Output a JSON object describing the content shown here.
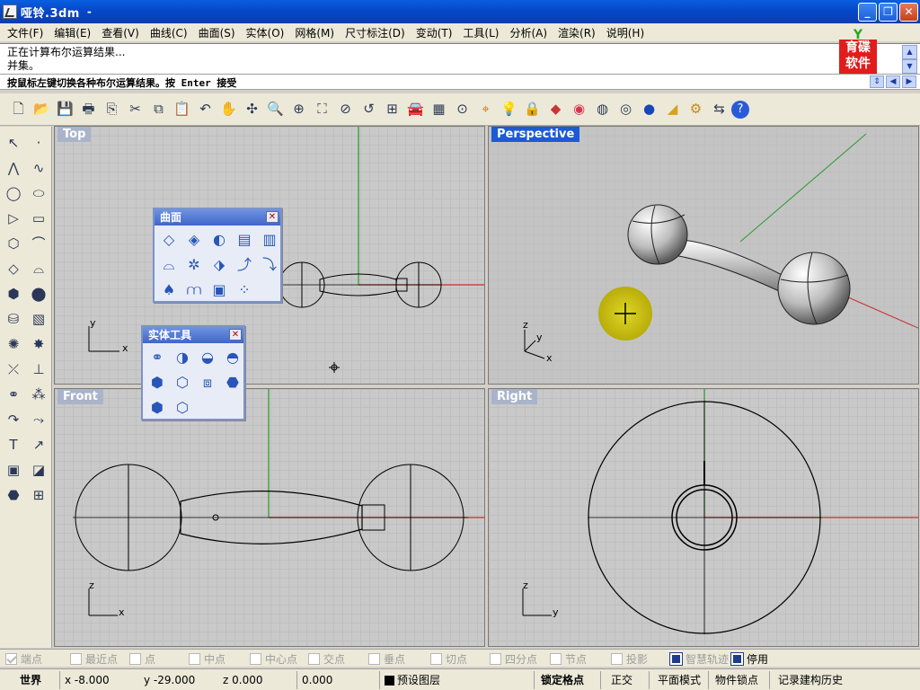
{
  "window": {
    "title": "哑铃.3dm",
    "title_suffix": "-"
  },
  "menu": [
    "文件(F)",
    "编辑(E)",
    "查看(V)",
    "曲线(C)",
    "曲面(S)",
    "实体(O)",
    "网格(M)",
    "尺寸标注(D)",
    "变动(T)",
    "工具(L)",
    "分析(A)",
    "渲染(R)",
    "说明(H)"
  ],
  "logo": {
    "line1": "育碟",
    "line2": "软件",
    "leaf": "Y"
  },
  "command": {
    "history": [
      "正在计算布尔运算结果...",
      "并集。"
    ],
    "prompt": "按鼠标左键切换各种布尔运算结果。按 Enter 接受"
  },
  "toolbar_icons": [
    "new-file-icon",
    "open-icon",
    "save-icon",
    "print-icon",
    "import-icon",
    "cut-icon",
    "copy-icon",
    "paste-icon",
    "undo-icon",
    "pan-hand-icon",
    "rotate-view-icon",
    "zoom-dynamic-icon",
    "zoom-window-icon",
    "zoom-extents-icon",
    "zoom-selected-icon",
    "undo-view-icon",
    "four-viewports-icon",
    "car-icon",
    "grid-icon",
    "snap-point-icon",
    "gumball-icon",
    "light-icon",
    "lock-icon",
    "layer-icon",
    "color-wheel-icon",
    "wireframe-icon",
    "ghost-sphere-icon",
    "shaded-sphere-icon",
    "render-icon",
    "settings-gear-icon",
    "history-icon",
    "help-icon"
  ],
  "viewports": {
    "top": "Top",
    "perspective": "Perspective",
    "front": "Front",
    "right": "Right"
  },
  "axes": {
    "x": "x",
    "y": "y",
    "z": "z"
  },
  "panels": {
    "surface": {
      "title": "曲面"
    },
    "solid": {
      "title": "实体工具"
    }
  },
  "colors": {
    "active_viewport": "#1a5bd6",
    "inactive_viewport": "#a9b4cb",
    "x_axis": "#cc2b2b",
    "y_axis": "#2c9a2c",
    "highlight": "#c9c100"
  },
  "snaps": [
    {
      "label": "端点",
      "checked": true,
      "enabled": false
    },
    {
      "label": "最近点",
      "checked": false,
      "enabled": false
    },
    {
      "label": "点",
      "checked": false,
      "enabled": false
    },
    {
      "label": "中点",
      "checked": false,
      "enabled": false
    },
    {
      "label": "中心点",
      "checked": false,
      "enabled": false
    },
    {
      "label": "交点",
      "checked": false,
      "enabled": false
    },
    {
      "label": "垂点",
      "checked": false,
      "enabled": false
    },
    {
      "label": "切点",
      "checked": false,
      "enabled": false
    },
    {
      "label": "四分点",
      "checked": false,
      "enabled": false
    },
    {
      "label": "节点",
      "checked": false,
      "enabled": false
    },
    {
      "label": "投影",
      "checked": false,
      "enabled": false
    },
    {
      "label": "智慧轨迹",
      "checked": true,
      "enabled": false
    },
    {
      "label": "停用",
      "checked": true,
      "enabled": true
    }
  ],
  "status": {
    "cplane": "世界",
    "x": "x -8.000",
    "y": "y -29.000",
    "z": "z 0.000",
    "dist": "0.000",
    "layer": "预设图层",
    "grid_snap": "锁定格点",
    "ortho": "正交",
    "planar": "平面模式",
    "osnap": "物件锁点",
    "history": "记录建构历史"
  }
}
